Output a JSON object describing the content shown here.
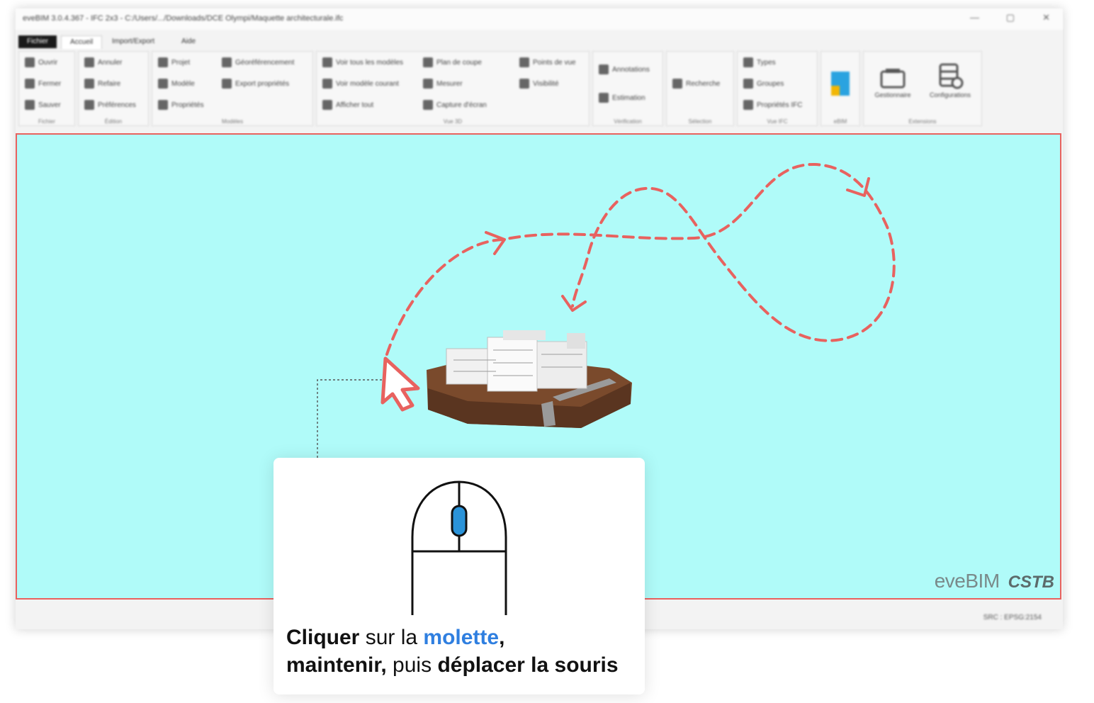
{
  "window": {
    "title": "eveBIM 3.0.4.367 - IFC 2x3 - C:/Users/.../Downloads/DCE Olympi/Maquette architecturale.ifc",
    "minimize_glyph": "—",
    "maximize_glyph": "▢",
    "close_glyph": "✕"
  },
  "tabs": [
    {
      "label": "Fichier"
    },
    {
      "label": "Accueil"
    },
    {
      "label": "Import/Export"
    },
    {
      "label": "Aide"
    }
  ],
  "ribbon": {
    "groups": [
      {
        "label": "Fichier",
        "items": [
          "Ouvrir",
          "Fermer",
          "Sauver"
        ]
      },
      {
        "label": "Édition",
        "items": [
          "Annuler",
          "Refaire",
          "Préférences"
        ]
      },
      {
        "label": "Modèles",
        "items": [
          "Projet",
          "Modèle",
          "Propriétés",
          "Géoréférencement",
          "Export propriétés"
        ]
      },
      {
        "label": "Vue 3D",
        "items": [
          "Voir tous les modèles",
          "Voir modèle courant",
          "Afficher tout",
          "Plan de coupe",
          "Mesurer",
          "Capture d'écran",
          "Points de vue",
          "Visibilité"
        ]
      },
      {
        "label": "Vérification",
        "items": [
          "Annotations",
          "Estimation"
        ]
      },
      {
        "label": "Sélection",
        "items": [
          "Recherche"
        ]
      },
      {
        "label": "Vue IFC",
        "items": [
          "Types",
          "Groupes",
          "Propriétés IFC"
        ]
      },
      {
        "label": "eBIM",
        "items": []
      },
      {
        "label": "Extensions",
        "items": [
          "Gestionnaire",
          "Configurations"
        ]
      }
    ]
  },
  "viewport": {
    "background_color": "#b0fbf9",
    "border_color": "#e8625f",
    "watermark_left": "eveBIM",
    "watermark_right": "CSTB"
  },
  "statusbar": {
    "text": "SRC : EPSG:2154"
  },
  "instruction": {
    "line1_bold": "Cliquer",
    "line1_mid": " sur la ",
    "line1_blue": "molette",
    "line1_end": ",",
    "line2_bold1": "maintenir,",
    "line2_mid": " puis ",
    "line2_bold2": "déplacer la souris",
    "accent_color": "#2f7fe0",
    "wheel_color": "#2a93d9"
  },
  "icons": {
    "cursor": "arrow-cursor-icon",
    "mouse": "mouse-icon",
    "path": "dashed-motion-path"
  }
}
